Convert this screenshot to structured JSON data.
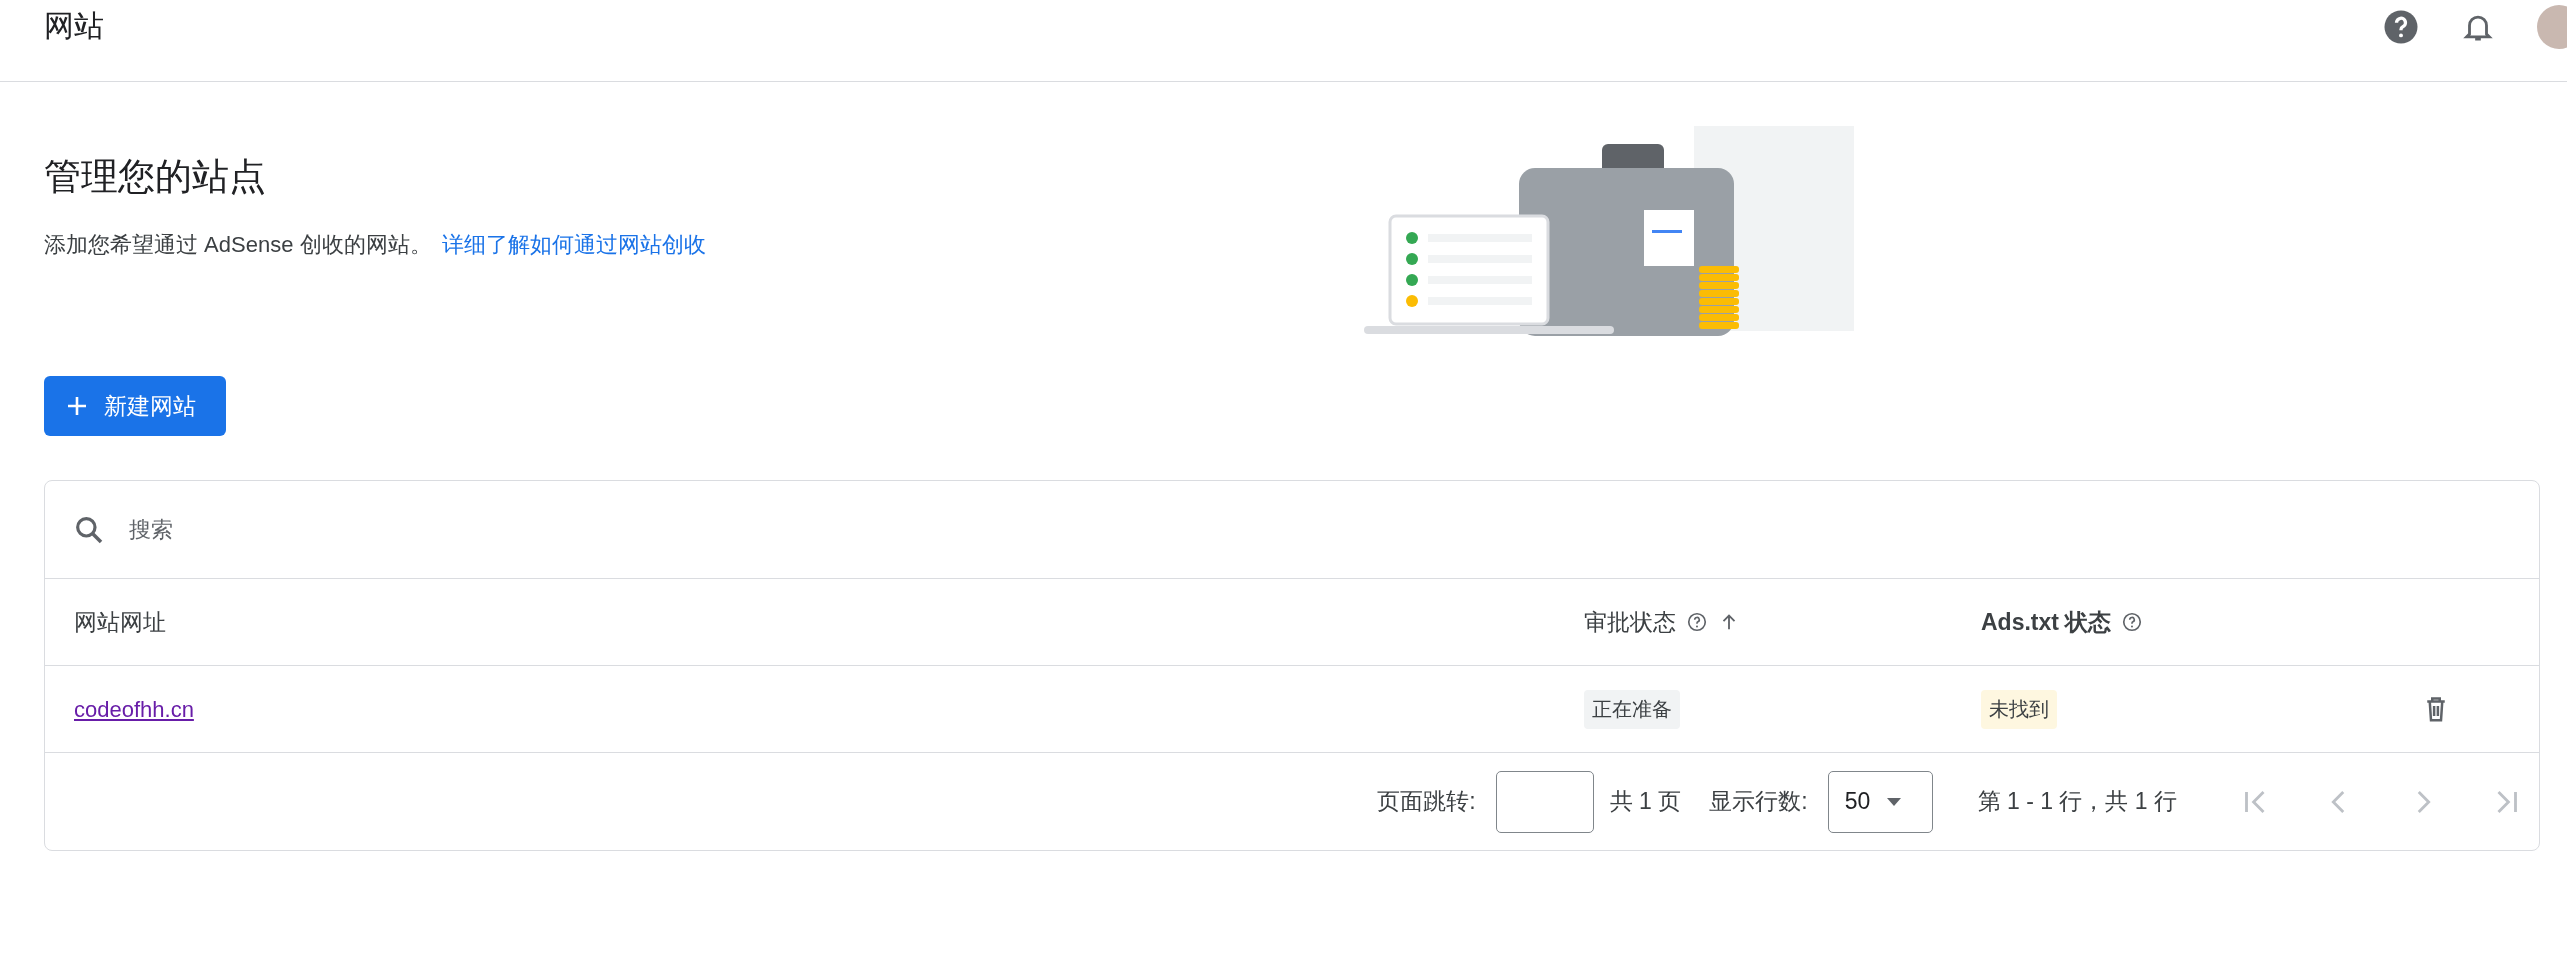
{
  "top_bar": {
    "title": "网站"
  },
  "header": {
    "title": "管理您的站点",
    "description": "添加您希望通过 AdSense 创收的网站。",
    "link": "详细了解如何通过网站创收"
  },
  "new_site_button": {
    "label": "新建网站"
  },
  "table": {
    "search": {
      "placeholder": "搜索"
    },
    "columns": [
      {
        "label": "网站网址",
        "help": false,
        "sorted": false,
        "bold": false
      },
      {
        "label": "审批状态",
        "help": true,
        "sorted": true,
        "bold": false
      },
      {
        "label": "Ads.txt 状态",
        "help": true,
        "sorted": false,
        "bold": true
      }
    ],
    "rows": [
      {
        "url": "codeofhh.cn",
        "approval": {
          "text": "正在准备",
          "kind": "neutral"
        },
        "ads_txt": {
          "text": "未找到",
          "kind": "warning"
        }
      }
    ],
    "pagination": {
      "jump_label": "页面跳转:",
      "total_pages": "共 1 页",
      "rows_label": "显示行数:",
      "rows_value": "50",
      "range": "第 1 - 1 行，共 1 行",
      "nav": [
        {
          "kind": "first",
          "disabled": true
        },
        {
          "kind": "prev",
          "disabled": true
        },
        {
          "kind": "next",
          "disabled": true
        },
        {
          "kind": "last",
          "disabled": true
        }
      ]
    }
  }
}
